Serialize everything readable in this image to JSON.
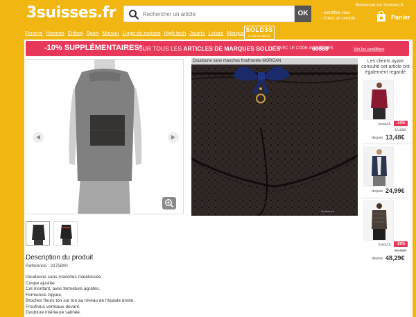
{
  "header": {
    "logo": "3suisses.fr",
    "search_placeholder": "Rechercher un article",
    "search_button": "OK",
    "welcome": "Bienvenue sur 3suisses.fr",
    "account_links": [
      "Identifiez-vous",
      "Créez un compte"
    ],
    "cart_label": "Panier"
  },
  "nav": {
    "items": [
      "Femme",
      "Homme",
      "Enfant",
      "Sport",
      "Maison",
      "Linge de maison",
      "High tech",
      "Jouets",
      "Loisirs",
      "Marques"
    ],
    "sold_title": "SOLD3S",
    "sold_subtitle": "et bonnes affaires"
  },
  "promo": {
    "big": "-10% SUPPLÉMENTAIRES*",
    "mid_prefix": "SUR TOUS LES",
    "mid_bold": "ARTICLES DE MARQUES SOLDÉS",
    "small": "AVEC LE CODE AVANTAGES",
    "code": "60868",
    "link": "Voir les conditions"
  },
  "product": {
    "zoom_caption": "Doudoune sans manches froufroutée MORGAN",
    "zoom_watermark": "3suisses.fr"
  },
  "reco": {
    "heading": "Les clients ayant consulté cet article ont également regardé",
    "items": [
      {
        "from": "jusqu'à",
        "old": "14,99€",
        "discount": "-10%",
        "from2": "depuis",
        "price": "13,48€"
      },
      {
        "from2": "depuis",
        "price": "24,99€"
      },
      {
        "from": "jusqu'à",
        "old": "69,00€",
        "discount": "-30%",
        "from2": "depuis",
        "price": "48,29€"
      }
    ]
  },
  "description": {
    "title": "Description du produit",
    "reference": "Référence : 2375800",
    "lines": [
      "Doudoune sans manches matelassée .",
      "Coupe ajustée.",
      "Col montant, avec fermeture agrafes.",
      "Fermeture zippée.",
      "Broches fleurs ton sur ton au niveau de l'épaule droite.",
      "Froufrous verticaux devant.",
      "Doublure intérieure satinée."
    ]
  },
  "colors": {
    "brand_yellow": "#f2b612",
    "promo_pink": "#e8385a",
    "garment": "#555555"
  },
  "icons": [
    "search-icon",
    "cart-icon",
    "arrow-left-icon",
    "arrow-right-icon",
    "zoom-icon"
  ]
}
